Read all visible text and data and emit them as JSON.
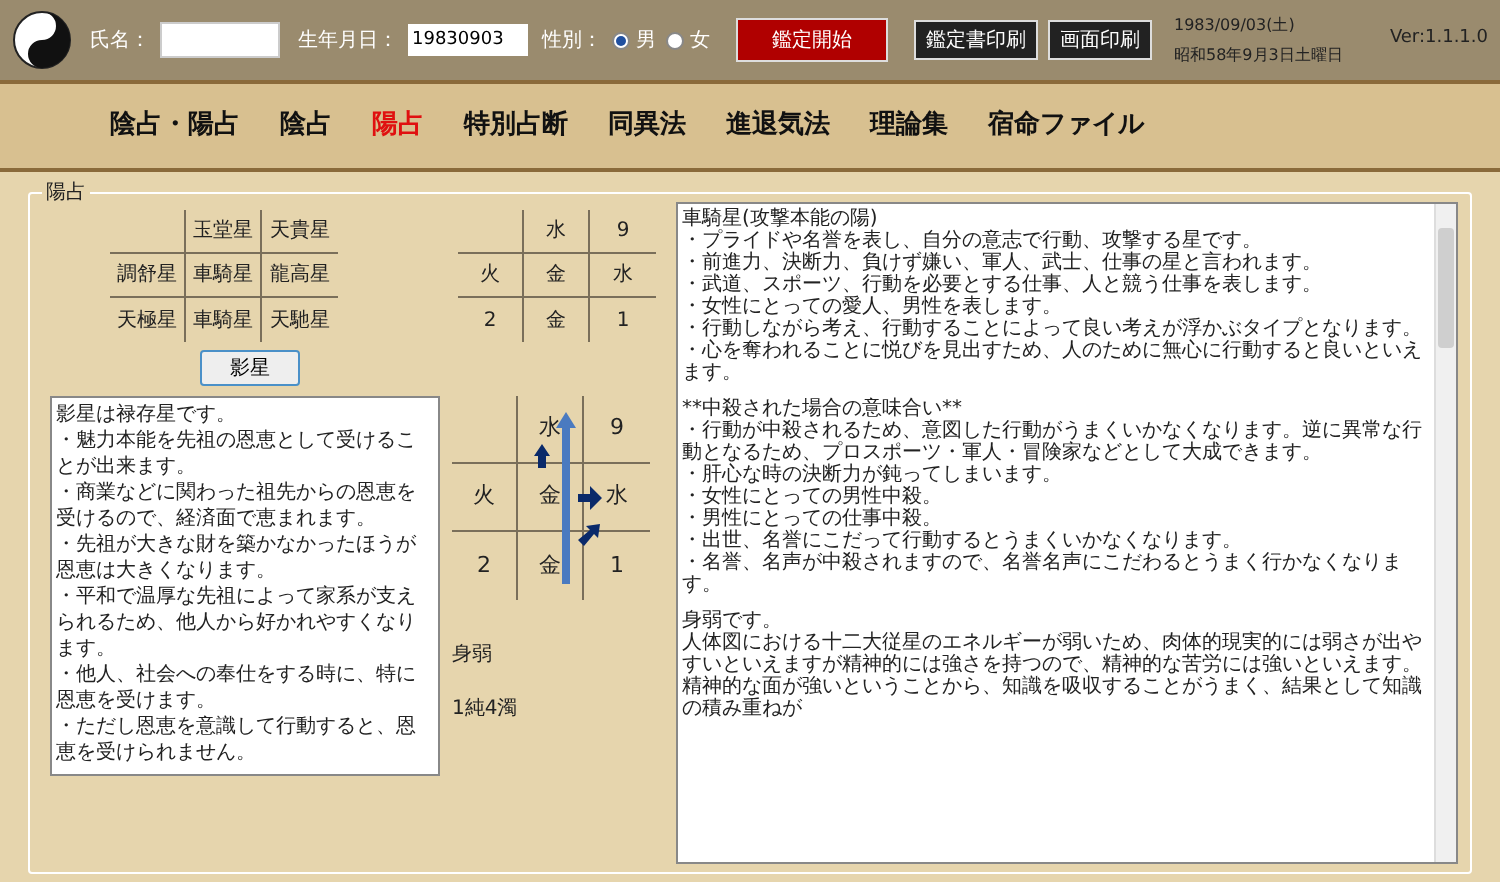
{
  "header": {
    "name_label": "氏名：",
    "birth_label": "生年月日：",
    "birth_value": "19830903",
    "gender_label": "性別：",
    "gender_options": [
      {
        "label": "男",
        "selected": true
      },
      {
        "label": "女",
        "selected": false
      }
    ],
    "start_button": "鑑定開始",
    "print_buttons": [
      "鑑定書印刷",
      "画面印刷"
    ],
    "date": "1983/09/03(土)",
    "japanese_date": "昭和58年9月3日土曜日",
    "version": "Ver:1.1.1.0"
  },
  "tabs": [
    {
      "label": "陰占・陽占",
      "selected": false
    },
    {
      "label": "陰占",
      "selected": false
    },
    {
      "label": "陽占",
      "selected": true
    },
    {
      "label": "特別占断",
      "selected": false
    },
    {
      "label": "同異法",
      "selected": false
    },
    {
      "label": "進退気法",
      "selected": false
    },
    {
      "label": "理論集",
      "selected": false
    },
    {
      "label": "宿命ファイル",
      "selected": false
    }
  ],
  "panel": {
    "title": "陽占",
    "star_table": [
      {
        "column_2": "玉堂星",
        "column_3": "天貴星"
      },
      {
        "column_1": "調舒星",
        "column_2": "車騎星",
        "column_3": "龍高星"
      },
      {
        "column_1": "天極星",
        "column_2": "車騎星",
        "column_3": "天馳星"
      }
    ],
    "element_grid": [
      {
        "column_2": "水",
        "column_3": "9"
      },
      {
        "column_1": "火",
        "column_2": "金",
        "column_3": "水"
      },
      {
        "column_1": "2",
        "column_2": "金",
        "column_3": "1"
      }
    ],
    "shadow_button": "影星",
    "shadow_text": [
      "影星は禄存星です。",
      "・魅力本能を先祖の恩恵として受けることが出来ます。",
      "・商業などに関わった祖先からの恩恵を受けるので、経済面で恵まれます。",
      "・先祖が大きな財を築かなかったほうが恩恵は大きくなります。",
      "・平和で温厚な先祖によって家系が支えられるため、他人から好かれやすくなります。",
      "・他人、社会への奉仕をする時に、特に恩恵を受けます。",
      "・ただし恩恵を意識して行動すると、恩恵を受けられません。"
    ],
    "flow_grid": [
      {
        "column_2": "水",
        "column_3": "9"
      },
      {
        "column_1": "火",
        "column_2": "金",
        "column_3": "水"
      },
      {
        "column_1": "2",
        "column_2": "金",
        "column_3": "1"
      }
    ],
    "strength": "身弱",
    "purity": "1純4濁",
    "detail_text": [
      {
        "text": "車騎星(攻撃本能の陽)",
        "gap_before": false
      },
      {
        "text": "・プライドや名誉を表し、自分の意志で行動、攻撃する星です。",
        "gap_before": false
      },
      {
        "text": "・前進力、決断力、負けず嫌い、軍人、武士、仕事の星と言われます。",
        "gap_before": false
      },
      {
        "text": "・武道、スポーツ、行動を必要とする仕事、人と競う仕事を表します。",
        "gap_before": false
      },
      {
        "text": "・女性にとっての愛人、男性を表します。",
        "gap_before": false
      },
      {
        "text": "・行動しながら考え、行動することによって良い考えが浮かぶタイプとなります。",
        "gap_before": false
      },
      {
        "text": "・心を奪われることに悦びを見出すため、人のために無心に行動すると良いといえます。",
        "gap_before": false
      },
      {
        "text": "**中殺された場合の意味合い**",
        "gap_before": true
      },
      {
        "text": "・行動が中殺されるため、意図した行動がうまくいかなくなります。逆に異常な行動となるため、プロスポーツ・軍人・冒険家などとして大成できます。",
        "gap_before": false
      },
      {
        "text": "・肝心な時の決断力が鈍ってしまいます。",
        "gap_before": false
      },
      {
        "text": "・女性にとっての男性中殺。",
        "gap_before": false
      },
      {
        "text": "・男性にとっての仕事中殺。",
        "gap_before": false
      },
      {
        "text": "・出世、名誉にこだって行動するとうまくいかなくなります。",
        "gap_before": false
      },
      {
        "text": "・名誉、名声が中殺されますので、名誉名声にこだわるとうまく行かなくなります。",
        "gap_before": false
      },
      {
        "text": "身弱です。",
        "gap_before": true
      },
      {
        "text": "人体図における十二大従星のエネルギーが弱いため、肉体的現実的には弱さが出やすいといえますが精神的には強さを持つので、精神的な苦労には強いといえます。",
        "gap_before": false
      },
      {
        "text": "精神的な面が強いということから、知識を吸収することがうまく、結果として知識の積み重ねが",
        "gap_before": false
      }
    ]
  }
}
